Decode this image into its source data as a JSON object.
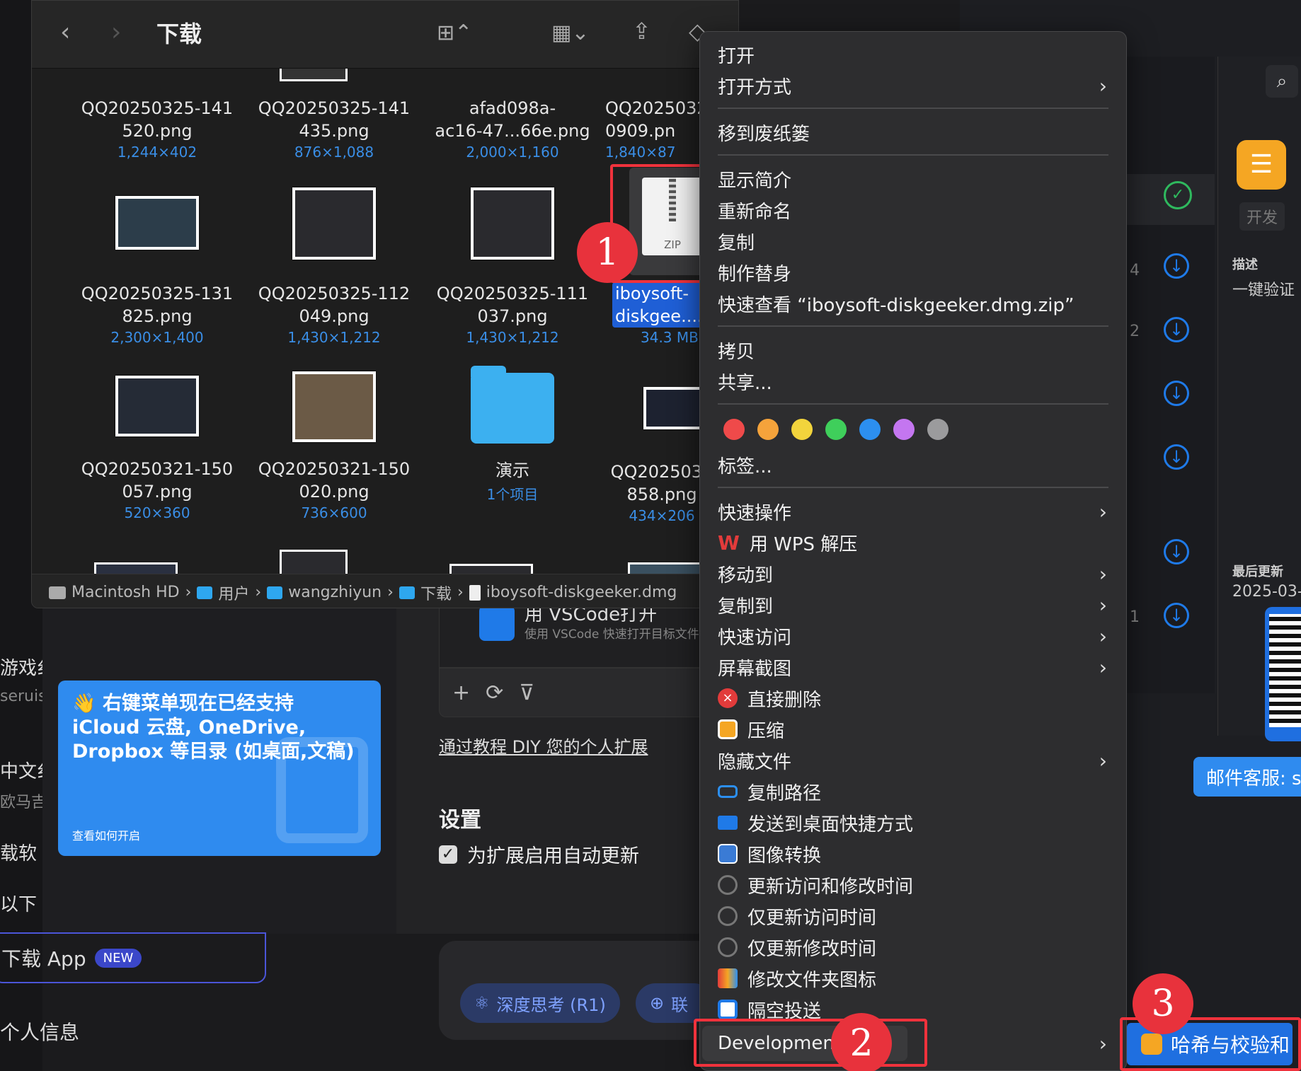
{
  "left_app": {
    "snippets": [
      "游戏纟",
      "seruis",
      "中文纟",
      "欧马吉",
      "载软",
      "以下"
    ]
  },
  "extension_window": {
    "promo": {
      "title": "👋 右键菜单现在已经支持 iCloud 云盘, OneDrive, Dropbox 等目录 (如桌面,文稿)",
      "link": "查看如何开启"
    },
    "vscode_row": {
      "title": "用 VSCode打开",
      "subtitle": "使用 VSCode 快速打开目标文件"
    },
    "diy_link": "通过教程 DIY 您的个人扩展",
    "settings_title": "设置",
    "auto_update": "为扩展启用自动更新",
    "download_app": "下载 App",
    "new_badge": "NEW",
    "personal_info": "个人信息",
    "pill_deep": "深度思考 (R1)",
    "pill_web": "联"
  },
  "finder": {
    "title": "下载",
    "items": [
      {
        "name": "QQ20250325-141\n520.png",
        "dims": "1,244×402"
      },
      {
        "name": "QQ20250325-141\n435.png",
        "dims": "876×1,088"
      },
      {
        "name": "afad098a-\nac16-47...66e.png",
        "dims": "2,000×1,160"
      },
      {
        "name": "QQ2025032\n0909.pn",
        "dims": "1,840×87"
      },
      {
        "name": "QQ20250325-131\n825.png",
        "dims": "2,300×1,400"
      },
      {
        "name": "QQ20250325-112\n049.png",
        "dims": "1,430×1,212"
      },
      {
        "name": "QQ20250325-111\n037.png",
        "dims": "1,430×1,212"
      },
      {
        "name": "iboysoft-\ndiskgee....dm",
        "dims": "34.3 MB"
      },
      {
        "name": "QQ20250321-150\n057.png",
        "dims": "520×360"
      },
      {
        "name": "QQ20250321-150\n020.png",
        "dims": "736×600"
      },
      {
        "name": "演示",
        "dims": "1个项目"
      },
      {
        "name": "QQ2025032\n858.png",
        "dims": "434×206"
      }
    ],
    "zip_label": "ZIP",
    "path": [
      "Macintosh HD",
      "用户",
      "wangzhiyun",
      "下载",
      "iboysoft-diskgeeker.dmg"
    ]
  },
  "right_app": {
    "tag": "开发",
    "desc_label": "描述",
    "desc": "一键验证",
    "updated_label": "最后更新",
    "updated": "2025-03-",
    "mail": "邮件客服: s",
    "side_nums": [
      "4",
      "2",
      "1"
    ]
  },
  "context_menu": {
    "open": "打开",
    "open_with": "打开方式",
    "trash": "移到废纸篓",
    "info": "显示简介",
    "rename": "重新命名",
    "duplicate": "复制",
    "alias": "制作替身",
    "quicklook": "快速查看 “iboysoft-diskgeeker.dmg.zip”",
    "copy": "拷贝",
    "share": "共享...",
    "tag_colors": [
      "#ef4a4a",
      "#f5a33b",
      "#f2d43c",
      "#3fcf5b",
      "#2c8ff0",
      "#c476f0",
      "#9b9b9d"
    ],
    "tags": "标签...",
    "quick_actions": "快速操作",
    "wps": "用 WPS 解压",
    "move_to": "移动到",
    "copy_to": "复制到",
    "quick_access": "快速访问",
    "screenshot": "屏幕截图",
    "delete": "直接删除",
    "compress": "压缩",
    "hide": "隐藏文件",
    "copy_path": "复制路径",
    "send_desktop": "发送到桌面快捷方式",
    "image_convert": "图像转换",
    "update_both": "更新访问和修改时间",
    "update_access": "仅更新访问时间",
    "update_modify": "仅更新修改时间",
    "folder_icon": "修改文件夹图标",
    "airdrop": "隔空投送",
    "development": "Development"
  },
  "submenu": {
    "hash": "哈希与校验和"
  },
  "badges": [
    "1",
    "2",
    "3"
  ]
}
